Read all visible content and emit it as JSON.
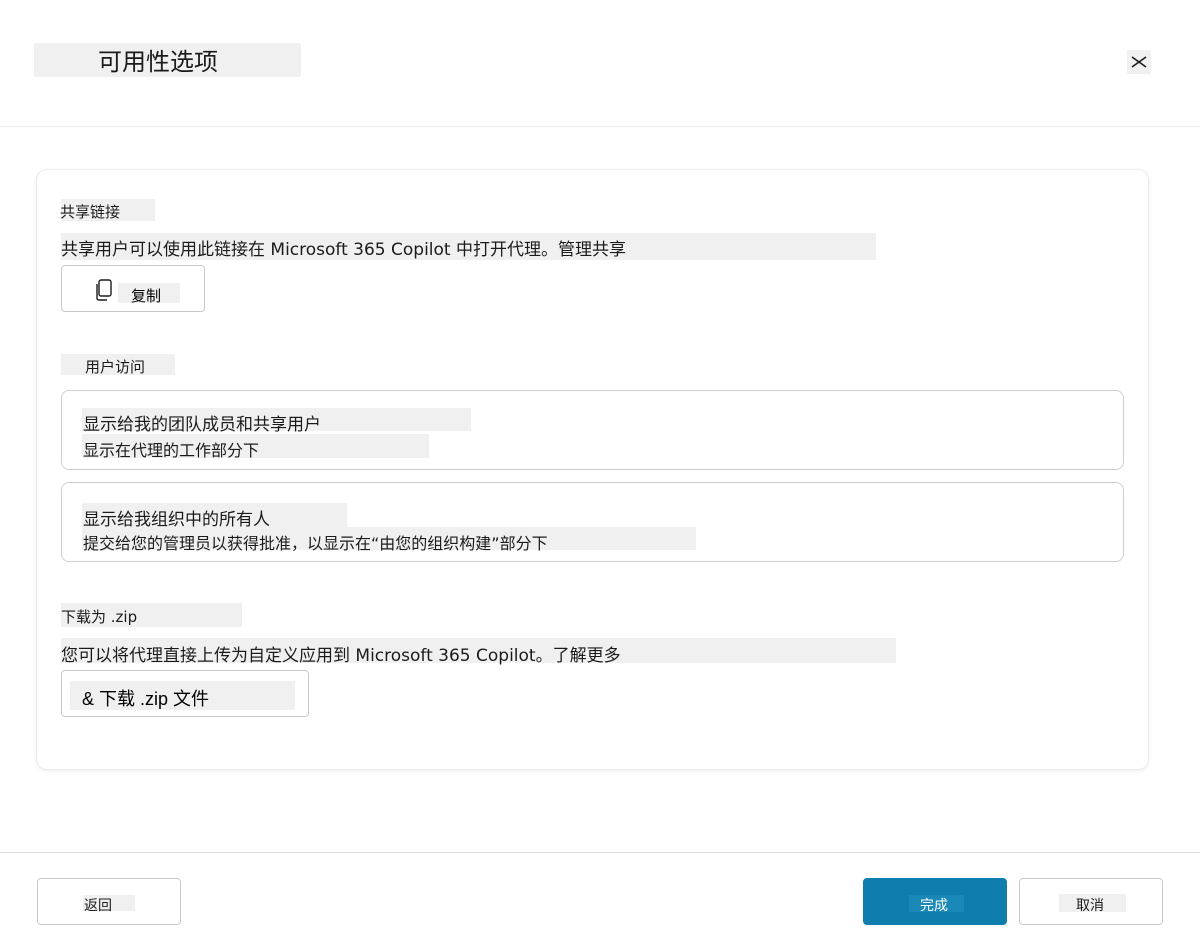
{
  "dialog": {
    "title": "可用性选项",
    "close_icon": "close-icon"
  },
  "share_link": {
    "label": "共享链接",
    "description": "共享用户可以使用此链接在 Microsoft 365 Copilot 中打开代理。管理共享",
    "copy_button_label": "复制",
    "copy_icon": "copy-icon"
  },
  "user_access": {
    "label": "用户访问",
    "options": [
      {
        "title": "显示给我的团队成员和共享用户",
        "subtitle": "显示在代理的工作部分下"
      },
      {
        "title": "显示给我组织中的所有人",
        "subtitle": "提交给您的管理员以获得批准，以显示在“由您的组织构建”部分下"
      }
    ]
  },
  "download": {
    "label": "下载为 .zip",
    "description": "您可以将代理直接上传为自定义应用到 Microsoft 365 Copilot。了解更多",
    "button_label": "& 下载 .zip 文件"
  },
  "footer": {
    "back_label": "返回",
    "done_label": "完成",
    "cancel_label": "取消"
  },
  "colors": {
    "primary_button": "#0f7eae",
    "highlight": "#f0f0f0",
    "border": "#c9c9c9"
  }
}
